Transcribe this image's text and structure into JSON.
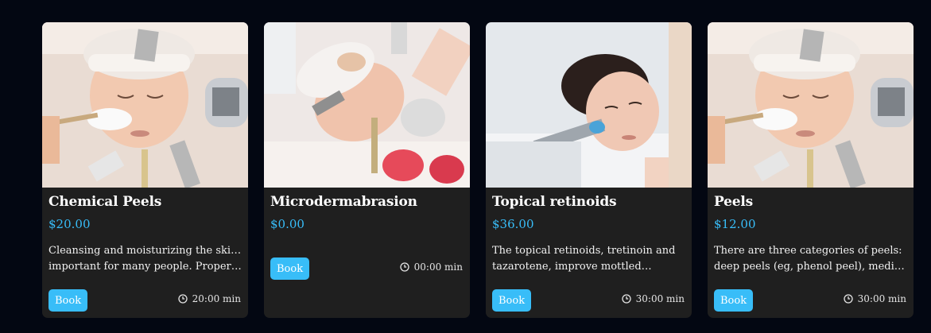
{
  "cards": [
    {
      "title": "Chemical Peels",
      "price": "$20.00",
      "desc_line1": "Cleansing and moisturizing the skin is",
      "desc_line2": "important for many people. Properly…",
      "book_label": "Book",
      "duration": "20:00 min",
      "clock_icon": "clock-icon"
    },
    {
      "title": "Microdermabrasion",
      "price": "$0.00",
      "desc_line1": "",
      "desc_line2": "",
      "book_label": "Book",
      "duration": "00:00 min",
      "clock_icon": "clock-icon"
    },
    {
      "title": "Topical retinoids",
      "price": "$36.00",
      "desc_line1": "The topical retinoids, tretinoin and",
      "desc_line2": "tazarotene, improve mottled…",
      "book_label": "Book",
      "duration": "30:00 min",
      "clock_icon": "clock-icon"
    },
    {
      "title": "Peels",
      "price": "$12.00",
      "desc_line1": "There are three categories of peels:",
      "desc_line2": "deep peels (eg, phenol peel), medium…",
      "book_label": "Book",
      "duration": "30:00 min",
      "clock_icon": "clock-icon"
    }
  ],
  "colors": {
    "page_bg": "#030712",
    "card_bg": "#1f1f1f",
    "accent": "#38bdf8"
  }
}
